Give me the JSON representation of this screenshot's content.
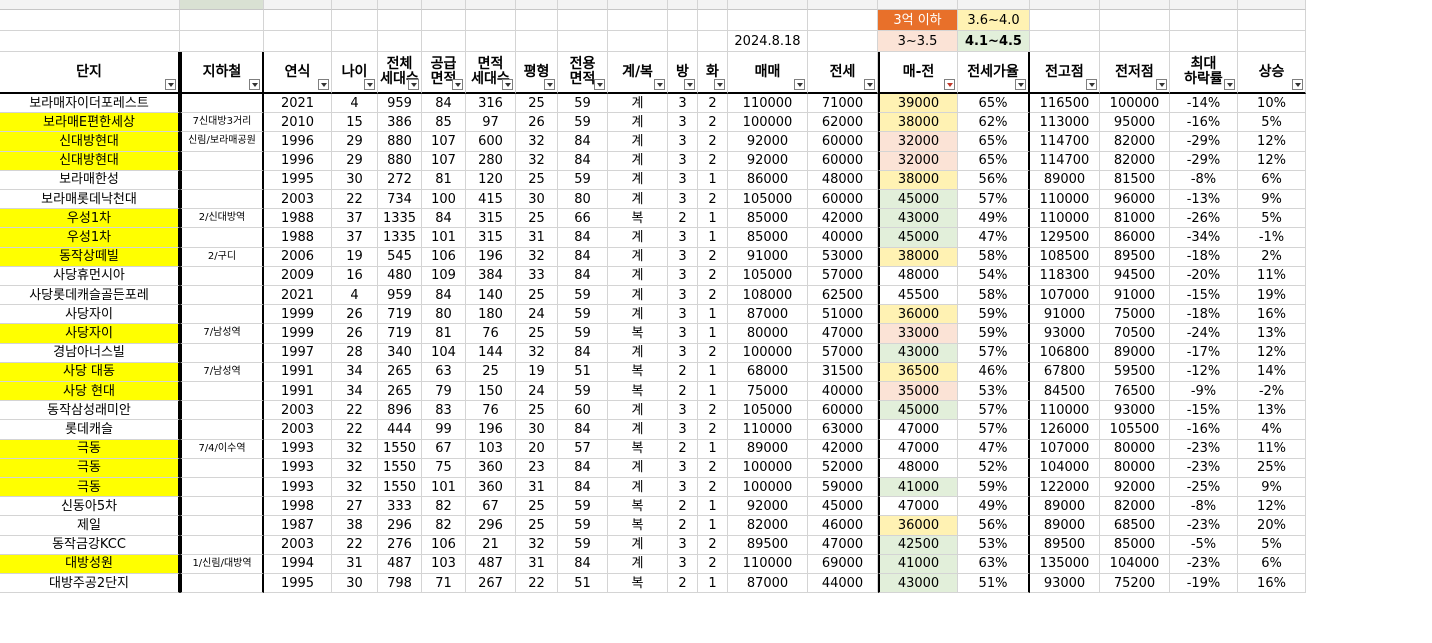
{
  "sheet": {
    "top_labels": {
      "date": "2024.8.18",
      "legend_under_3": "3억 이하",
      "legend_3_35": "3~3.5",
      "legend_36_40": "3.6~4.0",
      "legend_41_45": "4.1~4.5"
    },
    "headers": [
      {
        "l1": "단지",
        "l2": ""
      },
      {
        "l1": "지하철",
        "l2": ""
      },
      {
        "l1": "연식",
        "l2": ""
      },
      {
        "l1": "나이",
        "l2": ""
      },
      {
        "l1": "전체",
        "l2": "세대수"
      },
      {
        "l1": "공급",
        "l2": "면적"
      },
      {
        "l1": "면적",
        "l2": "세대수"
      },
      {
        "l1": "평형",
        "l2": ""
      },
      {
        "l1": "전용",
        "l2": "면적"
      },
      {
        "l1": "계/복",
        "l2": ""
      },
      {
        "l1": "방",
        "l2": ""
      },
      {
        "l1": "화",
        "l2": ""
      },
      {
        "l1": "매매",
        "l2": ""
      },
      {
        "l1": "전세",
        "l2": ""
      },
      {
        "l1": "매-전",
        "l2": ""
      },
      {
        "l1": "전세가율",
        "l2": ""
      },
      {
        "l1": "전고점",
        "l2": ""
      },
      {
        "l1": "전저점",
        "l2": ""
      },
      {
        "l1": "최대",
        "l2": "하락률"
      },
      {
        "l1": "상승",
        "l2": ""
      }
    ],
    "rows": [
      [
        "보라매자이더포레스트",
        "",
        "2021",
        "4",
        "959",
        "84",
        "316",
        "25",
        "59",
        "계",
        "3",
        "2",
        "110000",
        "71000",
        "39000",
        "65%",
        "116500",
        "100000",
        "-14%",
        "10%"
      ],
      [
        "보라매E편한세상",
        "7신대방3거리",
        "2010",
        "15",
        "386",
        "85",
        "97",
        "26",
        "59",
        "계",
        "3",
        "2",
        "100000",
        "62000",
        "38000",
        "62%",
        "113000",
        "95000",
        "-16%",
        "5%"
      ],
      [
        "신대방현대",
        "신림/보라매공원",
        "1996",
        "29",
        "880",
        "107",
        "600",
        "32",
        "84",
        "계",
        "3",
        "2",
        "92000",
        "60000",
        "32000",
        "65%",
        "114700",
        "82000",
        "-29%",
        "12%"
      ],
      [
        "신대방현대",
        "",
        "1996",
        "29",
        "880",
        "107",
        "280",
        "32",
        "84",
        "계",
        "3",
        "2",
        "92000",
        "60000",
        "32000",
        "65%",
        "114700",
        "82000",
        "-29%",
        "12%"
      ],
      [
        "보라매한성",
        "",
        "1995",
        "30",
        "272",
        "81",
        "120",
        "25",
        "59",
        "계",
        "3",
        "1",
        "86000",
        "48000",
        "38000",
        "56%",
        "89000",
        "81500",
        "-8%",
        "6%"
      ],
      [
        "보라매롯데낙천대",
        "",
        "2003",
        "22",
        "734",
        "100",
        "415",
        "30",
        "80",
        "계",
        "3",
        "2",
        "105000",
        "60000",
        "45000",
        "57%",
        "110000",
        "96000",
        "-13%",
        "9%"
      ],
      [
        "우성1차",
        "2/신대방역",
        "1988",
        "37",
        "1335",
        "84",
        "315",
        "25",
        "66",
        "복",
        "2",
        "1",
        "85000",
        "42000",
        "43000",
        "49%",
        "110000",
        "81000",
        "-26%",
        "5%"
      ],
      [
        "우성1차",
        "",
        "1988",
        "37",
        "1335",
        "101",
        "315",
        "31",
        "84",
        "계",
        "3",
        "1",
        "85000",
        "40000",
        "45000",
        "47%",
        "129500",
        "86000",
        "-34%",
        "-1%"
      ],
      [
        "동작상떼빌",
        "2/구디",
        "2006",
        "19",
        "545",
        "106",
        "196",
        "32",
        "84",
        "계",
        "3",
        "2",
        "91000",
        "53000",
        "38000",
        "58%",
        "108500",
        "89500",
        "-18%",
        "2%"
      ],
      [
        "사당휴먼시아",
        "",
        "2009",
        "16",
        "480",
        "109",
        "384",
        "33",
        "84",
        "계",
        "3",
        "2",
        "105000",
        "57000",
        "48000",
        "54%",
        "118300",
        "94500",
        "-20%",
        "11%"
      ],
      [
        "사당롯데캐슬골든포레",
        "",
        "2021",
        "4",
        "959",
        "84",
        "140",
        "25",
        "59",
        "계",
        "3",
        "2",
        "108000",
        "62500",
        "45500",
        "58%",
        "107000",
        "91000",
        "-15%",
        "19%"
      ],
      [
        "사당자이",
        "",
        "1999",
        "26",
        "719",
        "80",
        "180",
        "24",
        "59",
        "계",
        "3",
        "1",
        "87000",
        "51000",
        "36000",
        "59%",
        "91000",
        "75000",
        "-18%",
        "16%"
      ],
      [
        "사당자이",
        "7/남성역",
        "1999",
        "26",
        "719",
        "81",
        "76",
        "25",
        "59",
        "복",
        "3",
        "1",
        "80000",
        "47000",
        "33000",
        "59%",
        "93000",
        "70500",
        "-24%",
        "13%"
      ],
      [
        "경남아너스빌",
        "",
        "1997",
        "28",
        "340",
        "104",
        "144",
        "32",
        "84",
        "계",
        "3",
        "2",
        "100000",
        "57000",
        "43000",
        "57%",
        "106800",
        "89000",
        "-17%",
        "12%"
      ],
      [
        "사당 대동",
        "7/남성역",
        "1991",
        "34",
        "265",
        "63",
        "25",
        "19",
        "51",
        "복",
        "2",
        "1",
        "68000",
        "31500",
        "36500",
        "46%",
        "67800",
        "59500",
        "-12%",
        "14%"
      ],
      [
        "사당 현대",
        "",
        "1991",
        "34",
        "265",
        "79",
        "150",
        "24",
        "59",
        "복",
        "2",
        "1",
        "75000",
        "40000",
        "35000",
        "53%",
        "84500",
        "76500",
        "-9%",
        "-2%"
      ],
      [
        "동작삼성래미안",
        "",
        "2003",
        "22",
        "896",
        "83",
        "76",
        "25",
        "60",
        "계",
        "3",
        "2",
        "105000",
        "60000",
        "45000",
        "57%",
        "110000",
        "93000",
        "-15%",
        "13%"
      ],
      [
        "롯데캐슬",
        "",
        "2003",
        "22",
        "444",
        "99",
        "196",
        "30",
        "84",
        "계",
        "3",
        "2",
        "110000",
        "63000",
        "47000",
        "57%",
        "126000",
        "105500",
        "-16%",
        "4%"
      ],
      [
        "극동",
        "7/4/이수역",
        "1993",
        "32",
        "1550",
        "67",
        "103",
        "20",
        "57",
        "복",
        "2",
        "1",
        "89000",
        "42000",
        "47000",
        "47%",
        "107000",
        "80000",
        "-23%",
        "11%"
      ],
      [
        "극동",
        "",
        "1993",
        "32",
        "1550",
        "75",
        "360",
        "23",
        "84",
        "계",
        "3",
        "2",
        "100000",
        "52000",
        "48000",
        "52%",
        "104000",
        "80000",
        "-23%",
        "25%"
      ],
      [
        "극동",
        "",
        "1993",
        "32",
        "1550",
        "101",
        "360",
        "31",
        "84",
        "계",
        "3",
        "2",
        "100000",
        "59000",
        "41000",
        "59%",
        "122000",
        "92000",
        "-25%",
        "9%"
      ],
      [
        "신동아5차",
        "",
        "1998",
        "27",
        "333",
        "82",
        "67",
        "25",
        "59",
        "복",
        "2",
        "1",
        "92000",
        "45000",
        "47000",
        "49%",
        "89000",
        "82000",
        "-8%",
        "12%"
      ],
      [
        "제일",
        "",
        "1987",
        "38",
        "296",
        "82",
        "296",
        "25",
        "59",
        "복",
        "2",
        "1",
        "82000",
        "46000",
        "36000",
        "56%",
        "89000",
        "68500",
        "-23%",
        "20%"
      ],
      [
        "동작금강KCC",
        "",
        "2003",
        "22",
        "276",
        "106",
        "21",
        "32",
        "59",
        "계",
        "3",
        "2",
        "89500",
        "47000",
        "42500",
        "53%",
        "89500",
        "85000",
        "-5%",
        "5%"
      ],
      [
        "대방성원",
        "1/신림/대방역",
        "1994",
        "31",
        "487",
        "103",
        "487",
        "31",
        "84",
        "계",
        "3",
        "2",
        "110000",
        "69000",
        "41000",
        "63%",
        "135000",
        "104000",
        "-23%",
        "6%"
      ],
      [
        "대방주공2단지",
        "",
        "1995",
        "30",
        "798",
        "71",
        "267",
        "22",
        "51",
        "복",
        "2",
        "1",
        "87000",
        "44000",
        "43000",
        "51%",
        "93000",
        "75200",
        "-19%",
        "16%"
      ]
    ],
    "highlight_rows": [
      1,
      2,
      3,
      6,
      7,
      8,
      12,
      14,
      15,
      18,
      19,
      20,
      24
    ],
    "colors": {
      "yellow_name": "#ffff00",
      "band_peach": "#fbe3d6",
      "band_yellow": "#fff2b3",
      "band_green": "#e2efda",
      "legend_orange": "#e8702a"
    }
  }
}
